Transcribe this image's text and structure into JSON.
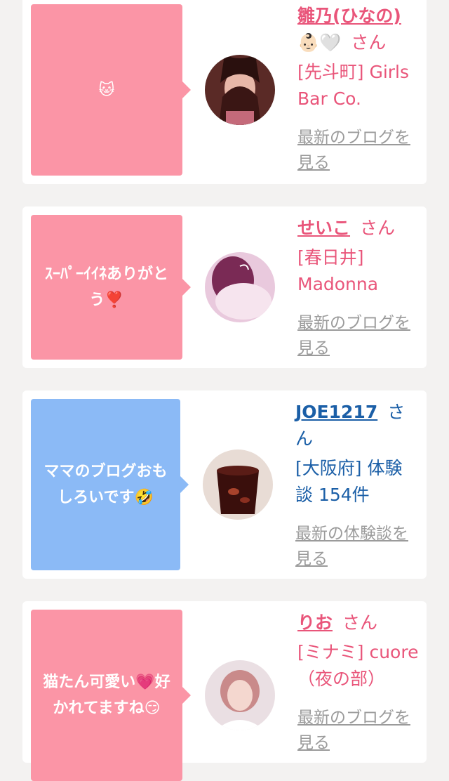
{
  "items": [
    {
      "message": "🐱",
      "name": "雛乃(ひなの)",
      "name_suffix": "👶🏻🤍",
      "honorific": "さん",
      "shop": "[先斗町] Girls Bar Co.",
      "link": "最新のブログを見る",
      "bubble_color": "#fb95a6"
    },
    {
      "message": "ｽｰﾊﾟｰｲｲﾈありがとう❣️",
      "name": "せいこ",
      "honorific": "さん",
      "shop": "[春日井] Madonna",
      "link": "最新のブログを見る",
      "bubble_color": "#fb95a6"
    },
    {
      "message": "ママのブログおもしろいです🤣",
      "name": "JOE1217",
      "honorific": "さん",
      "shop": "[大阪府] 体験談 154件",
      "link": "最新の体験談を見る",
      "bubble_color": "#8bbaf6"
    },
    {
      "message": "猫たん可愛い💗好かれてますね😏",
      "name": "りお",
      "honorific": "さん",
      "shop": "[ミナミ] cuore（夜の部）",
      "link": "最新のブログを見る",
      "bubble_color": "#fb95a6"
    }
  ]
}
